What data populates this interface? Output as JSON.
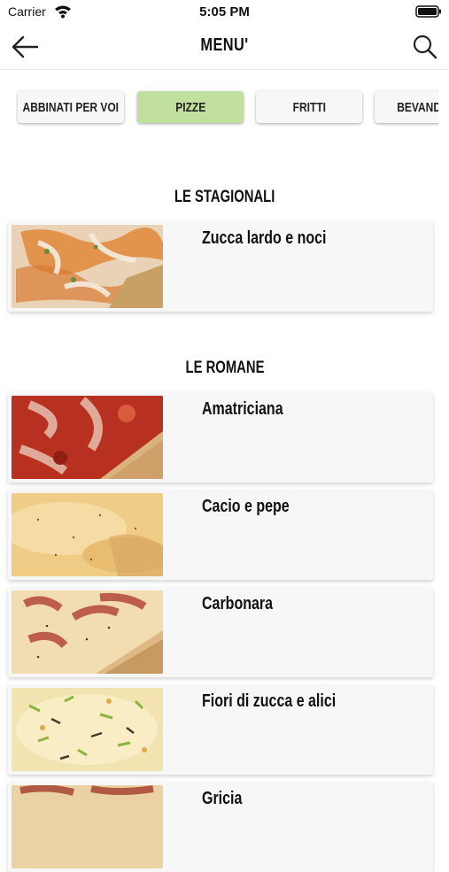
{
  "status": {
    "carrier": "Carrier",
    "time": "5:05 PM"
  },
  "header": {
    "title": "MENU'",
    "back_icon": "arrow-left-icon",
    "search_icon": "search-icon"
  },
  "tabs": [
    {
      "label": "ABBINATI PER VOI",
      "active": false
    },
    {
      "label": "PIZZE",
      "active": true
    },
    {
      "label": "FRITTI",
      "active": false
    },
    {
      "label": "BEVANDE",
      "active": false
    }
  ],
  "colors": {
    "active_tab": "#c1df9e",
    "card_bg": "#f7f7f7"
  },
  "sections": [
    {
      "title": "LE STAGIONALI",
      "items": [
        {
          "name": "Zucca lardo e noci"
        }
      ]
    },
    {
      "title": "LE ROMANE",
      "items": [
        {
          "name": "Amatriciana"
        },
        {
          "name": "Cacio e pepe"
        },
        {
          "name": "Carbonara"
        },
        {
          "name": "Fiori di zucca e alici"
        },
        {
          "name": "Gricia"
        }
      ]
    }
  ]
}
